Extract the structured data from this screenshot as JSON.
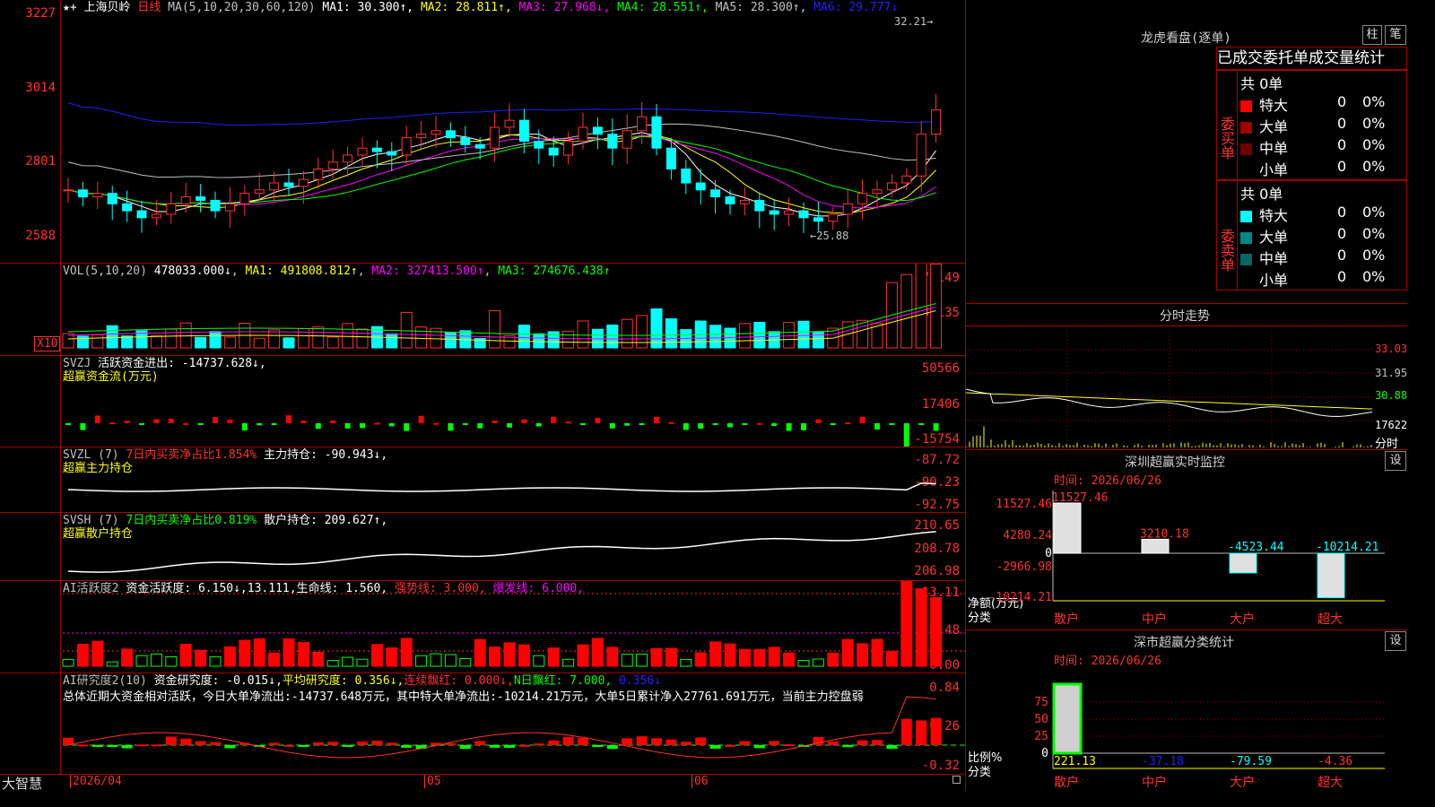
{
  "k": {
    "stock": "上海贝岭",
    "period": "日线",
    "ma_label": "MA(5,10,20,30,60,120)",
    "ma": [
      {
        "label": "MA1:",
        "val": "30.300↑",
        "color": "#ffffff"
      },
      {
        "label": "MA2:",
        "val": "28.811↑",
        "color": "#ffff00"
      },
      {
        "label": "MA3:",
        "val": "27.968↓",
        "color": "#ff00ff"
      },
      {
        "label": "MA4:",
        "val": "28.551↑",
        "color": "#00ff00"
      },
      {
        "label": "MA5:",
        "val": "28.300↑",
        "color": "#c0c0c0"
      },
      {
        "label": "MA6:",
        "val": "29.777↓",
        "color": "#2020ff"
      }
    ],
    "ticks": [
      "3227",
      "3014",
      "2801",
      "2588"
    ],
    "hi": "32.21",
    "lo": "←25.88"
  },
  "vol": {
    "label": "VOL(5,10,20)",
    "val": "478033.000↓",
    "ma1": "MA1: 491808.812↑",
    "ma2": "MA2: 327413.500↑",
    "ma3": "MA3: 274676.438↑",
    "ticks": [
      "71149",
      "35135"
    ],
    "unit": "X10"
  },
  "svzj": {
    "label": "SVZJ",
    "t1": "活跃资金进出: -14737.628↓,",
    "t2": "超赢资金流(万元)",
    "ticks": [
      "50566",
      "17406",
      "-15754"
    ]
  },
  "svzl": {
    "label": "SVZL (7)",
    "t1": "7日内买卖净占比1.854%",
    "t2": "主力持仓: -90.943↓,",
    "t3": "超赢主力持仓",
    "ticks": [
      "-87.72",
      "-90.23",
      "-92.75"
    ]
  },
  "svsh": {
    "label": "SVSH (7)",
    "t1": "7日内买卖净占比0.819%",
    "t2": "散户持仓: 209.627↑,",
    "t3": "超赢散户持仓",
    "ticks": [
      "210.65",
      "208.78",
      "206.98"
    ]
  },
  "ai1": {
    "t0": "AI活跃度2",
    "t1": "资金活跃度: 6.150↓,",
    "t2": "13.111,",
    "t3": "生命线: 1.560,",
    "t4": "强势线: 3.000,",
    "t5": "爆发线: 6.000,",
    "ticks": [
      "13.11",
      "6.48",
      "0.00"
    ]
  },
  "ai2": {
    "t0": "AI研究度2(10)",
    "t1": "资金研究度: -0.015↓,",
    "t2": "平均研究度: 0.356↓,",
    "t3": "连续飘红: 0.000↓,",
    "t4": "N日飘红: 7.000,",
    "t5": "0.356↓",
    "summary": "总体近期大资金相对活跃，今日大单净流出:-14737.648万元，其中特大单净流出:-10214.21万元，大单5日累计净入27761.691万元，当前主力控盘弱",
    "ticks": [
      "0.84",
      "0.26",
      "-0.32"
    ]
  },
  "bottom": {
    "brand": "大智慧",
    "d1": "2026/04",
    "d2": "05",
    "d3": "06"
  },
  "lh": {
    "title": "龙虎看盘(逐单)",
    "b1": "柱",
    "b2": "笔",
    "h1": "已成交",
    "h2": "委托单",
    "h3": "成交量统计",
    "buy": "委买单",
    "sell": "委卖单",
    "total": "共 0单",
    "rows": [
      {
        "n": "特大",
        "v": "0",
        "p": "0%"
      },
      {
        "n": "大单",
        "v": "0",
        "p": "0%"
      },
      {
        "n": "中单",
        "v": "0",
        "p": "0%"
      },
      {
        "n": "小单",
        "v": "0",
        "p": "0%"
      }
    ]
  },
  "fs": {
    "title": "分时走势",
    "ticks": [
      "33.03",
      "31.95",
      "30.88",
      "17622"
    ],
    "lbl": "分时"
  },
  "sz": {
    "title": "深圳超赢实时监控",
    "btn": "设",
    "time": "时间: 2026/06/26",
    "ticks": [
      "11527.46",
      "4280.24",
      "0",
      "-2966.98",
      "-10214.21"
    ],
    "vals": [
      "11527.46",
      "3210.18",
      "-4523.44",
      "-10214.21"
    ],
    "yl": "净额(万元)",
    "xl": "分类",
    "cats": [
      "散户",
      "中户",
      "大户",
      "超大"
    ]
  },
  "sh": {
    "title": "深市超赢分类统计",
    "btn": "设",
    "time": "时间: 2026/06/26",
    "ticks": [
      "75",
      "50",
      "25",
      "0"
    ],
    "vals": [
      "221.13",
      "-37.18",
      "-79.59",
      "-4.36"
    ],
    "yl": "比例%",
    "xl": "分类",
    "cats": [
      "散户",
      "中户",
      "大户",
      "超大"
    ]
  }
}
